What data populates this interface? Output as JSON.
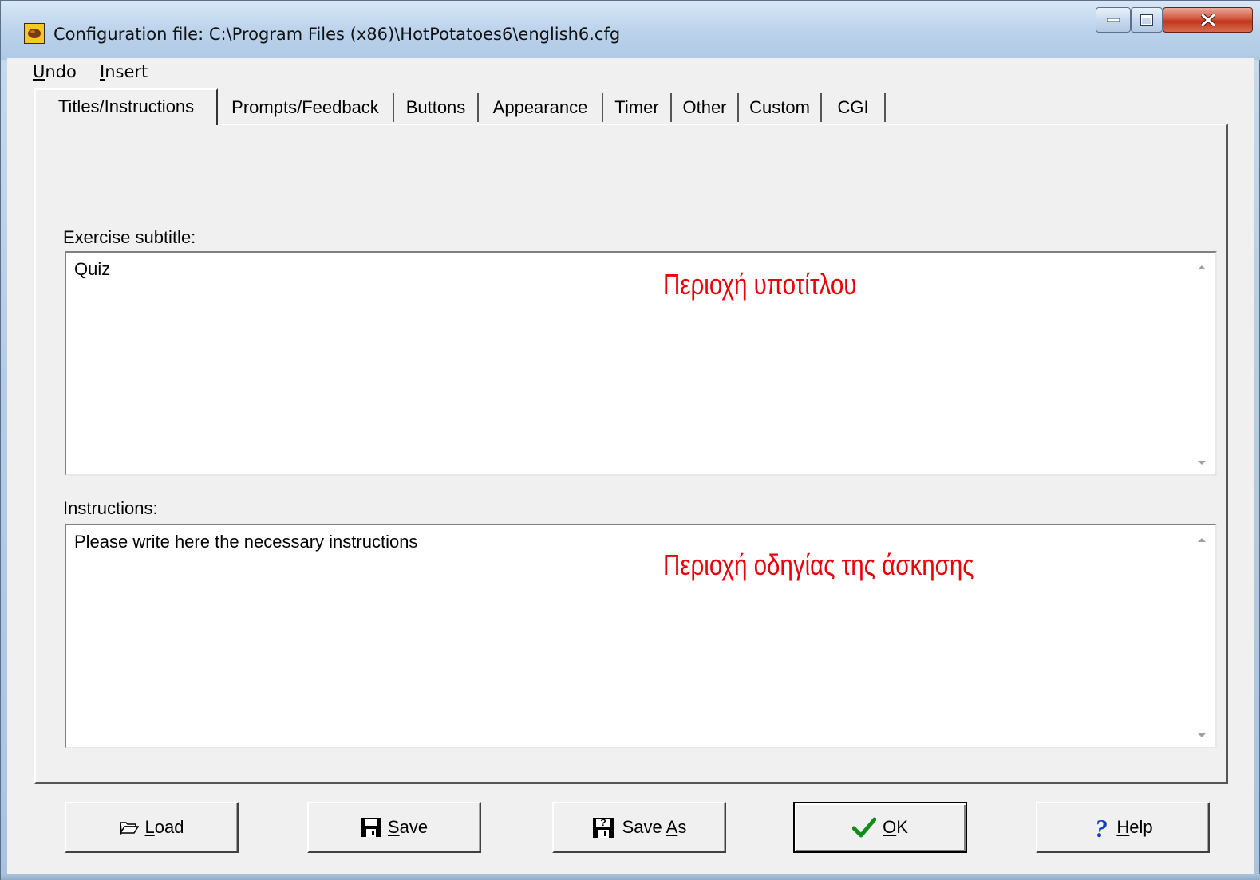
{
  "window": {
    "title": "Configuration file: C:\\Program Files (x86)\\HotPotatoes6\\english6.cfg"
  },
  "menu": {
    "undo_first": "U",
    "undo_rest": "ndo",
    "insert_first": "I",
    "insert_rest": "nsert"
  },
  "tabs": [
    {
      "label": "Titles/Instructions",
      "active": true
    },
    {
      "label": "Prompts/Feedback"
    },
    {
      "label": "Buttons"
    },
    {
      "label": "Appearance"
    },
    {
      "label": "Timer"
    },
    {
      "label": "Other"
    },
    {
      "label": "Custom"
    },
    {
      "label": "CGI"
    }
  ],
  "fields": {
    "subtitle_label": "Exercise subtitle:",
    "subtitle_value": "Quiz",
    "instructions_label": "Instructions:",
    "instructions_value": "Please write here the necessary instructions"
  },
  "annotations": {
    "subtitle_area": "Περιοχή υποτίτλου",
    "instructions_area": "Περιοχή οδηγίας της άσκησης",
    "color": "#e8000b"
  },
  "buttons": {
    "load": {
      "mnemonic": "L",
      "rest": "oad",
      "icon": "folder-open-icon"
    },
    "save": {
      "mnemonic": "S",
      "rest": "ave",
      "icon": "floppy-disk-icon"
    },
    "save_as": {
      "prefix": "Save ",
      "mnemonic": "A",
      "rest": "s",
      "icon": "save-as-icon"
    },
    "ok": {
      "mnemonic": "O",
      "rest": "K",
      "icon": "checkmark-icon"
    },
    "help": {
      "mnemonic": "H",
      "rest": "elp",
      "icon": "question-mark-icon"
    }
  }
}
